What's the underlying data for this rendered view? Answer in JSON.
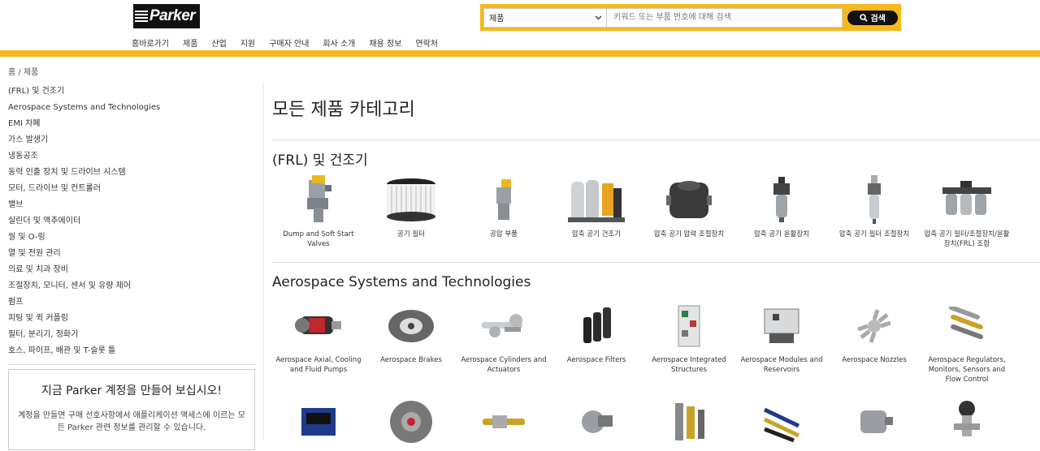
{
  "header": {
    "logo_text": "Parker",
    "nav": [
      "홈바로가기",
      "제품",
      "산업",
      "지원",
      "구매자 안내",
      "회사 소개",
      "채용 정보",
      "연락처"
    ],
    "search": {
      "category_selected": "제품",
      "placeholder": "키워드 또는 부품 번호에 대해 검색",
      "button_label": "검색"
    }
  },
  "breadcrumb": "홈 / 제품",
  "sidebar": {
    "items": [
      "(FRL) 및 건조기",
      "Aerospace Systems and Technologies",
      "EMI 차폐",
      "가스 발생기",
      "냉동공조",
      "동력 인출 장치 및 드라이브 시스템",
      "모터, 드라이브 및 컨트롤러",
      "밸브",
      "실린더 및 액추에이터",
      "씰 및 O-링",
      "열 및 전원 관리",
      "의료 및 치과 장비",
      "조절장치, 모니터, 센서 및 유량 제어",
      "펌프",
      "피팅 및 퀵 커플링",
      "필터, 분리기, 정화기",
      "호스, 파이프, 배관 및 T-슬롯 틀"
    ],
    "account_box": {
      "title": "지금 Parker 계정을 만들어 보십시오!",
      "description": "계정을 만들면 구매 선호사항에서 애플리케이션 액세스에 이르는 모든 Parker 관련 정보를 관리할 수 있습니다."
    }
  },
  "main": {
    "title": "모든 제품 카테고리",
    "sections": [
      {
        "title": "(FRL) 및 건조기",
        "products": [
          {
            "label": "Dump and Soft Start Valves",
            "icon": "valve-icon"
          },
          {
            "label": "공기 필터",
            "icon": "filter-icon"
          },
          {
            "label": "공압 부품",
            "icon": "pneumatic-icon"
          },
          {
            "label": "압축 공기 건조기",
            "icon": "dryer-icon"
          },
          {
            "label": "압축 공기 압력 조절장치",
            "icon": "regulator-icon"
          },
          {
            "label": "압축 공기 윤활장치",
            "icon": "lubricator-icon"
          },
          {
            "label": "압축 공기 필터 조절장치",
            "icon": "filter-regulator-icon"
          },
          {
            "label": "압축 공기 필터/조절장치/윤활장치(FRL) 조합",
            "icon": "frl-icon"
          }
        ]
      },
      {
        "title": "Aerospace Systems and Technologies",
        "products": [
          {
            "label": "Aerospace Axial, Cooling and Fluid Pumps",
            "icon": "pump-icon"
          },
          {
            "label": "Aerospace Brakes",
            "icon": "brake-icon"
          },
          {
            "label": "Aerospace Cylinders and Actuators",
            "icon": "cylinder-icon"
          },
          {
            "label": "Aerospace Filters",
            "icon": "aero-filter-icon"
          },
          {
            "label": "Aerospace Integrated Structures",
            "icon": "structure-icon"
          },
          {
            "label": "Aerospace Modules and Reservoirs",
            "icon": "module-icon"
          },
          {
            "label": "Aerospace Nozzles",
            "icon": "nozzle-icon"
          },
          {
            "label": "Aerospace Regulators, Monitors, Sensors and Flow Control",
            "icon": "sensor-icon"
          }
        ]
      },
      {
        "title": "",
        "products": [
          {
            "label": "",
            "icon": "control-unit-icon"
          },
          {
            "label": "",
            "icon": "wheel-icon"
          },
          {
            "label": "",
            "icon": "actuator-icon"
          },
          {
            "label": "",
            "icon": "valve-assembly-icon"
          },
          {
            "label": "",
            "icon": "fitting-icon"
          },
          {
            "label": "",
            "icon": "hose-icon"
          },
          {
            "label": "",
            "icon": "housing-icon"
          },
          {
            "label": "",
            "icon": "gauge-valve-icon"
          }
        ]
      }
    ]
  },
  "colors": {
    "brand_yellow": "#f7b81d",
    "brand_black": "#111111"
  }
}
